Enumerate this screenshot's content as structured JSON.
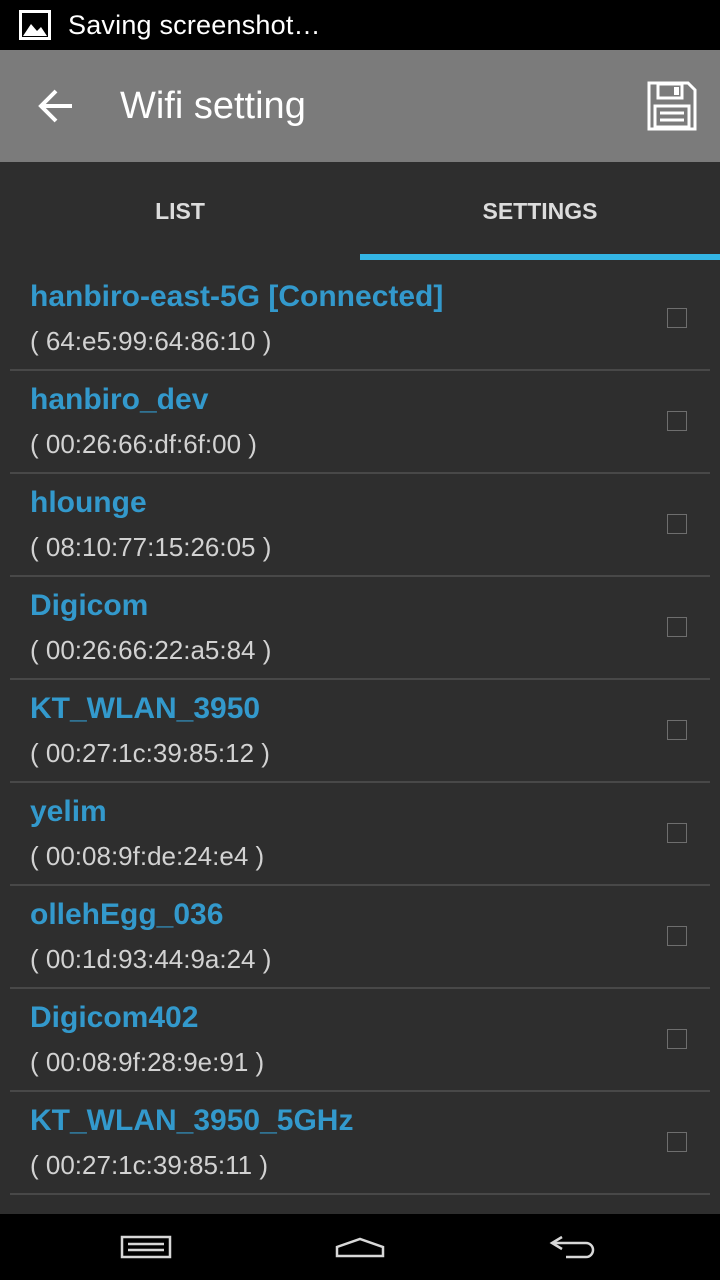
{
  "status_bar": {
    "icon": "image-icon",
    "text": "Saving screenshot…"
  },
  "action_bar": {
    "back_icon": "arrow-left-icon",
    "title": "Wifi setting",
    "save_icon": "floppy-disk-icon"
  },
  "tabs": [
    {
      "label": "LIST",
      "selected": false
    },
    {
      "label": "SETTINGS",
      "selected": true
    }
  ],
  "accent_color": "#33b5e5",
  "networks": [
    {
      "name": "hanbiro-east-5G [Connected]",
      "mac": "( 64:e5:99:64:86:10 )",
      "checked": false
    },
    {
      "name": "hanbiro_dev",
      "mac": "( 00:26:66:df:6f:00 )",
      "checked": false
    },
    {
      "name": "hlounge",
      "mac": "( 08:10:77:15:26:05 )",
      "checked": false
    },
    {
      "name": "Digicom",
      "mac": "( 00:26:66:22:a5:84 )",
      "checked": false
    },
    {
      "name": "KT_WLAN_3950",
      "mac": "( 00:27:1c:39:85:12 )",
      "checked": false
    },
    {
      "name": "yelim",
      "mac": "( 00:08:9f:de:24:e4 )",
      "checked": false
    },
    {
      "name": "ollehEgg_036",
      "mac": "( 00:1d:93:44:9a:24 )",
      "checked": false
    },
    {
      "name": "Digicom402",
      "mac": "( 00:08:9f:28:9e:91 )",
      "checked": false
    },
    {
      "name": "KT_WLAN_3950_5GHz",
      "mac": "( 00:27:1c:39:85:11 )",
      "checked": false
    }
  ],
  "nav_bar": {
    "recent_icon": "recent-apps-icon",
    "home_icon": "home-icon",
    "back_icon": "back-icon"
  }
}
